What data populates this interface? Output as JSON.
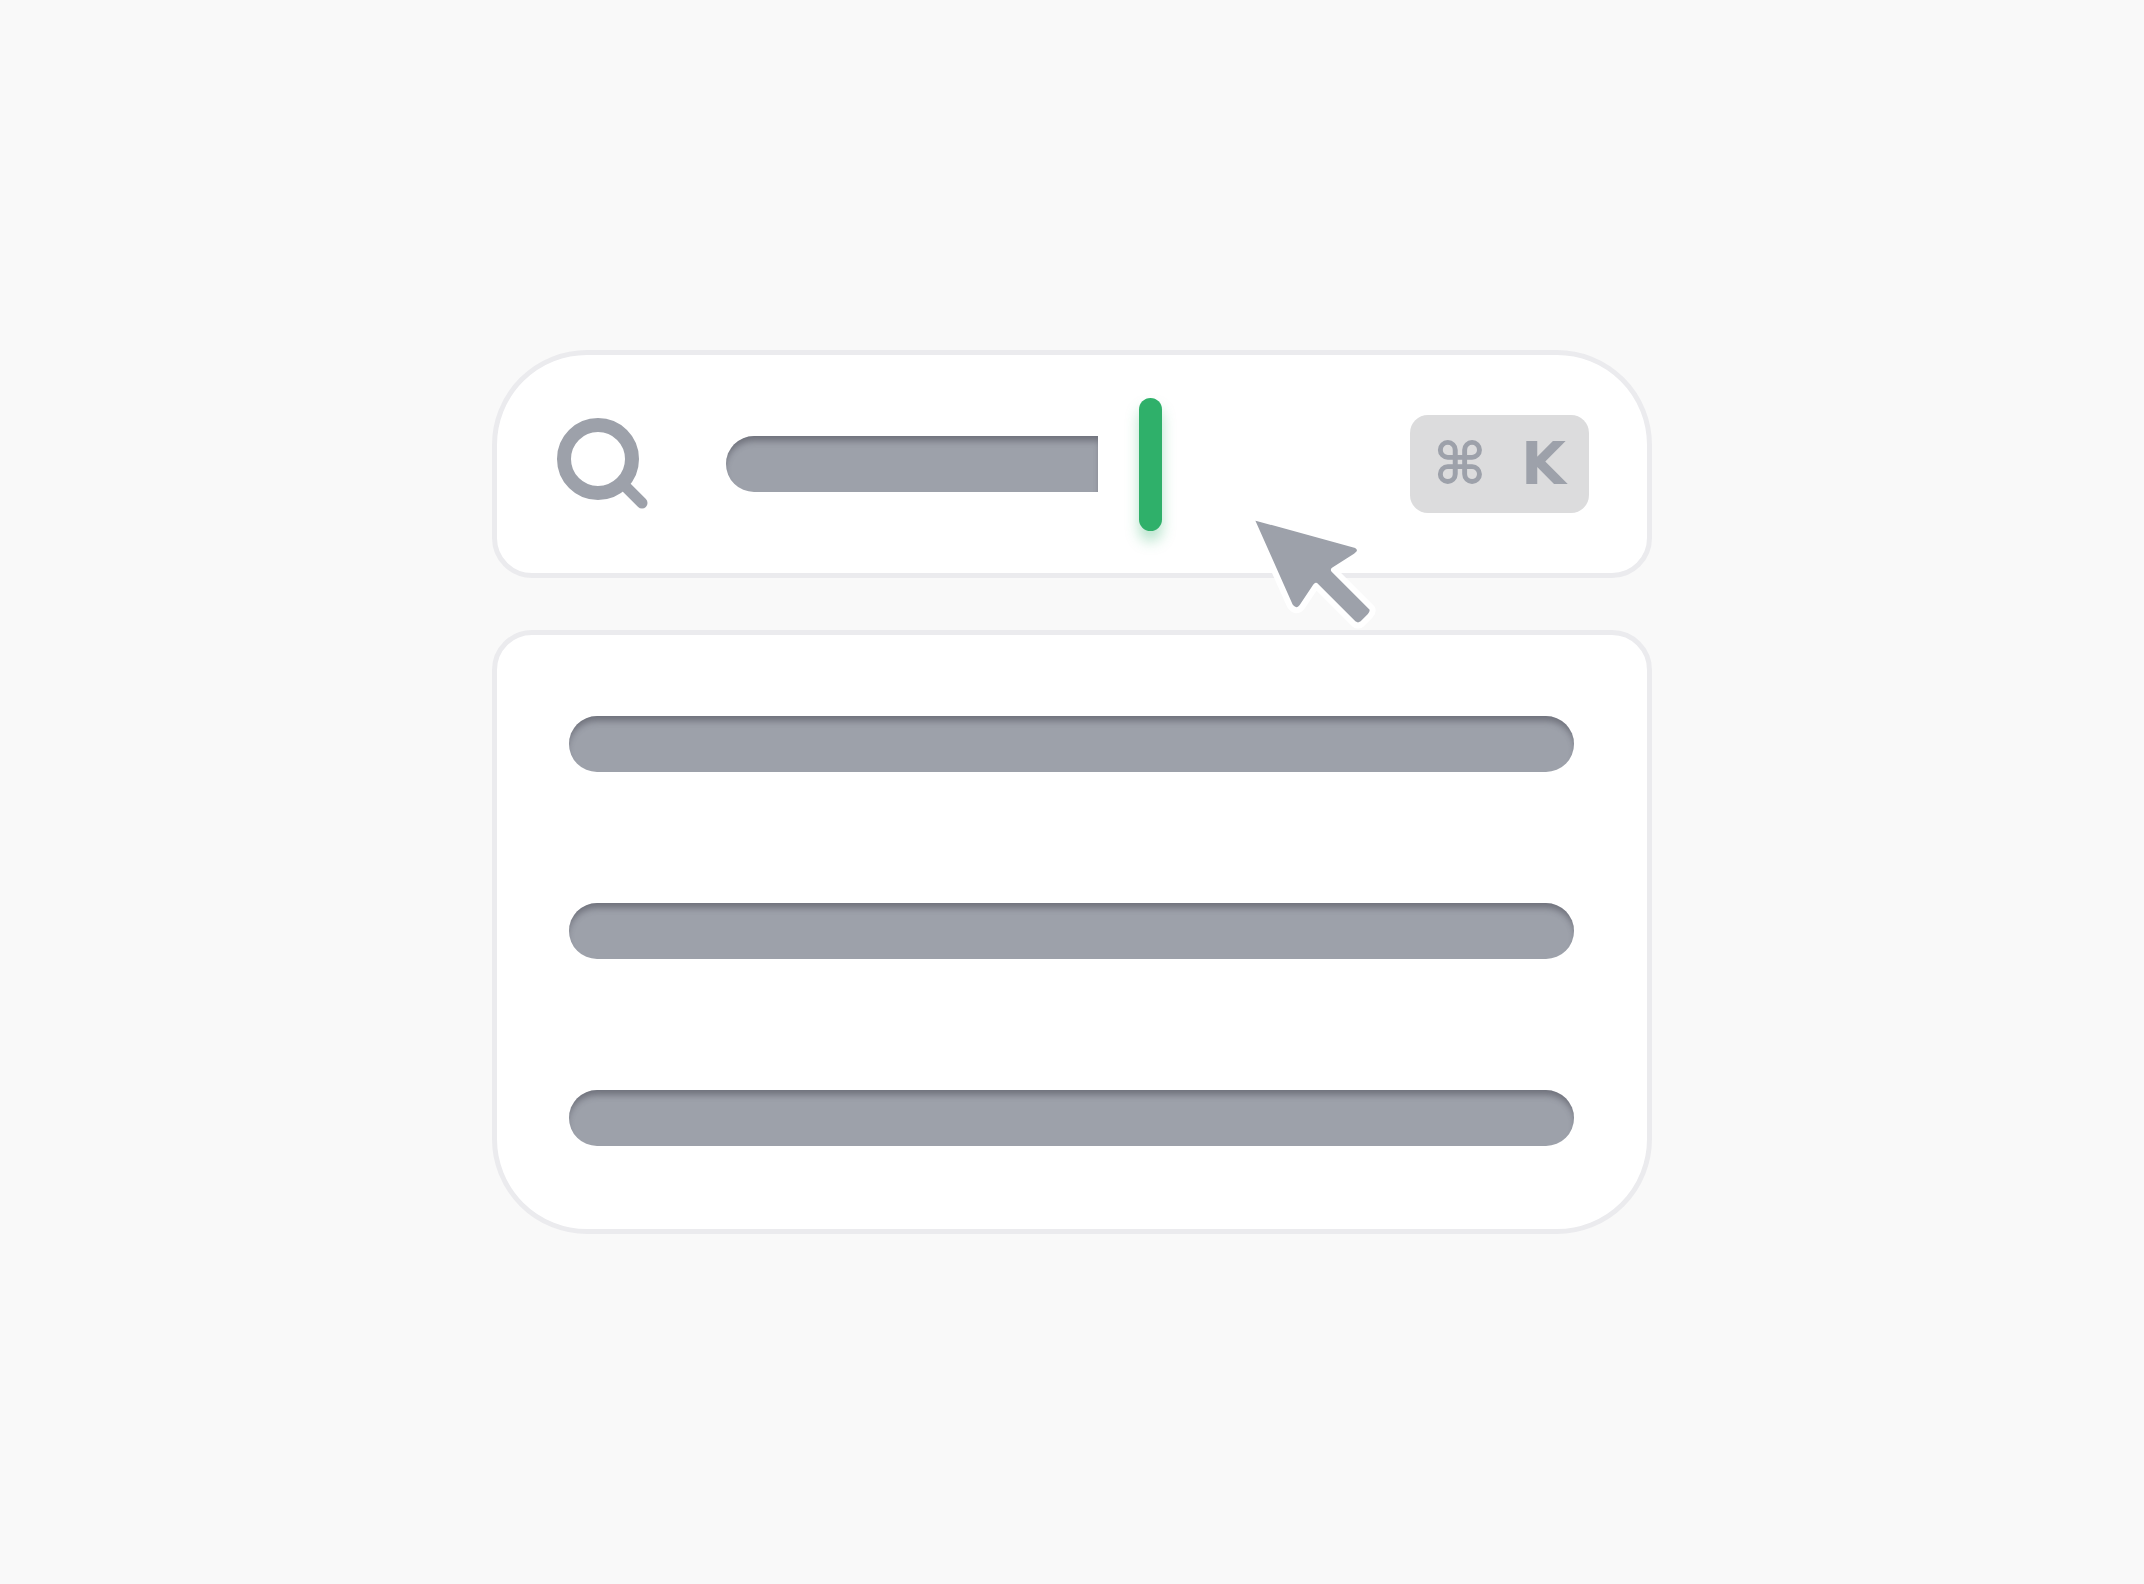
{
  "shortcut": {
    "symbol": "⌘",
    "key": "K"
  }
}
